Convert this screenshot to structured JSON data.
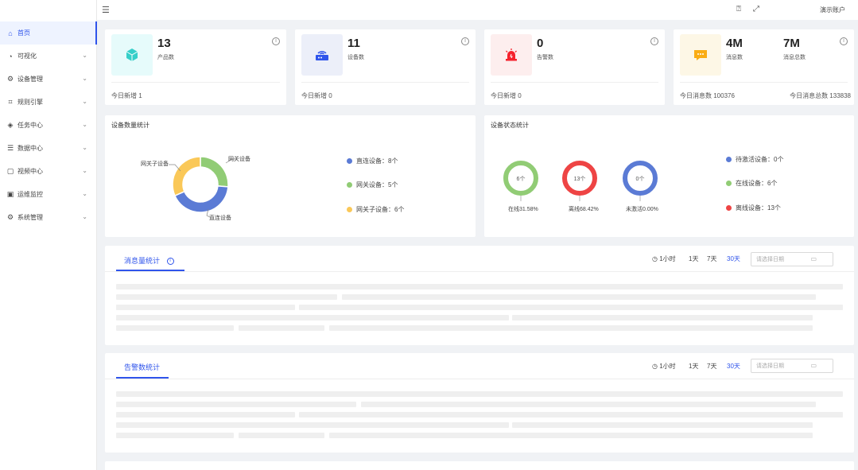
{
  "sidebar": {
    "items": [
      {
        "label": "首页",
        "icon": "home-icon",
        "glyph": "⌂",
        "active": true,
        "expandable": false
      },
      {
        "label": "可视化",
        "icon": "chart-icon",
        "glyph": "◔",
        "active": false,
        "expandable": true
      },
      {
        "label": "设备管理",
        "icon": "device-icon",
        "glyph": "⚙",
        "active": false,
        "expandable": true
      },
      {
        "label": "规则引擎",
        "icon": "rule-icon",
        "glyph": "⌗",
        "active": false,
        "expandable": true
      },
      {
        "label": "任务中心",
        "icon": "task-icon",
        "glyph": "◈",
        "active": false,
        "expandable": true
      },
      {
        "label": "数据中心",
        "icon": "data-icon",
        "glyph": "☰",
        "active": false,
        "expandable": true
      },
      {
        "label": "视频中心",
        "icon": "video-icon",
        "glyph": "▢",
        "active": false,
        "expandable": true
      },
      {
        "label": "运维监控",
        "icon": "monitor-icon",
        "glyph": "▣",
        "active": false,
        "expandable": true
      },
      {
        "label": "系统管理",
        "icon": "settings-icon",
        "glyph": "⚙",
        "active": false,
        "expandable": true
      }
    ]
  },
  "header": {
    "menu_icon": "menu-fold-icon",
    "help_icon": "help-icon",
    "fullscreen_icon": "fullscreen-icon",
    "user": "演示账户"
  },
  "stats": [
    {
      "value": "13",
      "label": "产品数",
      "footer": "今日新增 1",
      "icon": "cube-icon",
      "icon_bg": "#e6fbfb",
      "icon_color": "#36cfc9"
    },
    {
      "value": "11",
      "label": "设备数",
      "footer": "今日新增 0",
      "icon": "router-icon",
      "icon_bg": "#eceff9",
      "icon_color": "#2f54eb"
    },
    {
      "value": "0",
      "label": "告警数",
      "footer": "今日新增 0",
      "icon": "alarm-icon",
      "icon_bg": "#fdeeee",
      "icon_color": "#f5222d"
    },
    {
      "value": "4M",
      "label": "消息数",
      "value2": "7M",
      "label2": "消息总数",
      "footer": "今日消息数 100376",
      "footer2": "今日消息总数 133838",
      "icon": "message-icon",
      "icon_bg": "#fdf7e6",
      "icon_color": "#faad14"
    }
  ],
  "device_count": {
    "title": "设备数量统计",
    "chart_data": {
      "type": "pie",
      "labels": [
        "直连设备",
        "网关设备",
        "网关子设备"
      ],
      "values": [
        8,
        5,
        6
      ],
      "colors": [
        "#5b7bd5",
        "#91cc75",
        "#fac858"
      ],
      "slice_labels": [
        "直连设备",
        "网关设备",
        "网关子设备"
      ],
      "legend": [
        "直连设备：8个",
        "网关设备：5个",
        "网关子设备：6个"
      ]
    }
  },
  "device_status": {
    "title": "设备状态统计",
    "chart_data": {
      "type": "pie",
      "rings": [
        {
          "center": "6个",
          "caption": "在线31.58%",
          "value": 31.58,
          "color": "#91cc75"
        },
        {
          "center": "13个",
          "caption": "离线68.42%",
          "value": 68.42,
          "color": "#ee4444"
        },
        {
          "center": "0个",
          "caption": "未激活0.00%",
          "value": 0,
          "color": "#5b7bd5"
        }
      ],
      "legend": [
        {
          "text": "待激活设备：0个",
          "color": "#5b7bd5"
        },
        {
          "text": "在线设备：6个",
          "color": "#91cc75"
        },
        {
          "text": "离线设备：13个",
          "color": "#ee4444"
        }
      ]
    }
  },
  "message_panel": {
    "tab": "消息量统计",
    "filters": [
      "1小时",
      "1天",
      "7天",
      "30天"
    ],
    "active_filter": "30天",
    "date_placeholder": "请选择日期"
  },
  "alarm_panel": {
    "tab": "告警数统计",
    "filters": [
      "1小时",
      "1天",
      "7天",
      "30天"
    ],
    "active_filter": "30天",
    "date_placeholder": "请选择日期"
  }
}
